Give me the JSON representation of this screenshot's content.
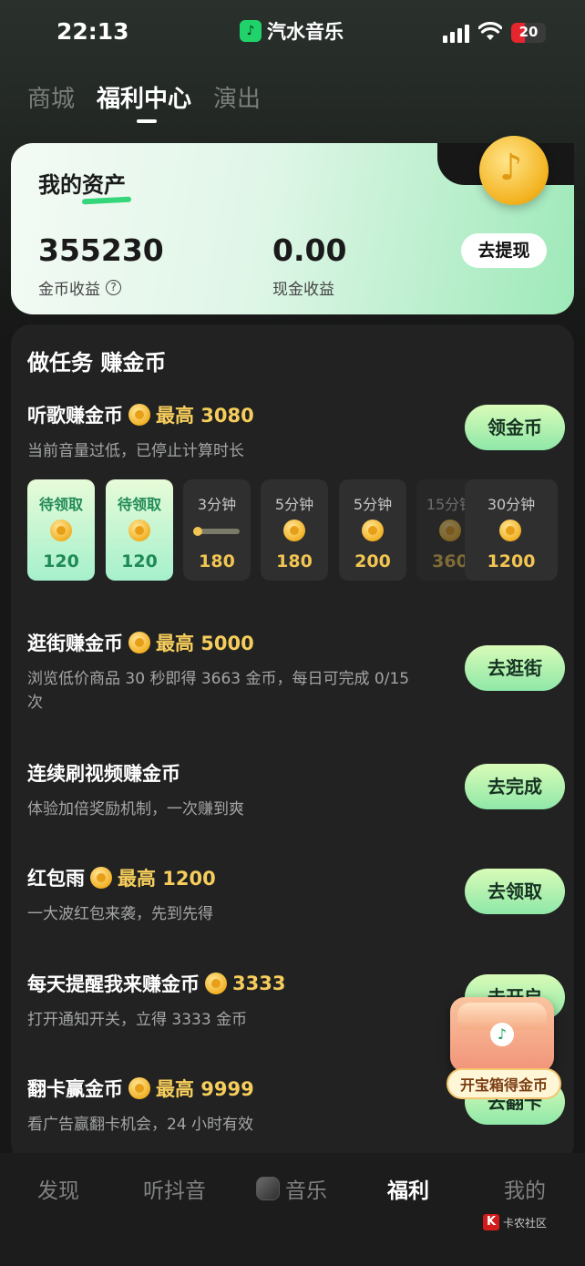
{
  "status": {
    "time": "22:13",
    "app_name": "汽水音乐",
    "battery": "20"
  },
  "top_tabs": [
    "商城",
    "福利中心",
    "演出"
  ],
  "assets": {
    "title_prefix": "我的",
    "title_highlight": "资产",
    "coins_value": "355230",
    "coins_label": "金币收益",
    "cash_value": "0.00",
    "cash_label": "现金收益",
    "withdraw_label": "去提现"
  },
  "tasks": {
    "title": "做任务 赚金币",
    "listen": {
      "title": "听歌赚金币",
      "reward": "最高 3080",
      "subtitle": "当前音量过低，已停止计算时长",
      "button": "领金币",
      "slots": [
        {
          "label": "待领取",
          "amount": "120",
          "state": "claim"
        },
        {
          "label": "待领取",
          "amount": "120",
          "state": "claim"
        },
        {
          "label": "3分钟",
          "amount": "180",
          "state": "progress",
          "progress": 0.05
        },
        {
          "label": "5分钟",
          "amount": "180",
          "state": "locked"
        },
        {
          "label": "5分钟",
          "amount": "200",
          "state": "locked"
        },
        {
          "label": "15分钟",
          "amount": "360",
          "state": "dim"
        },
        {
          "label": "30分钟",
          "amount": "1200",
          "state": "locked"
        }
      ]
    },
    "shop": {
      "title": "逛街赚金币",
      "reward": "最高 5000",
      "subtitle": "浏览低价商品 30 秒即得 3663 金币，每日可完成 0/15 次",
      "button": "去逛街"
    },
    "video": {
      "title": "连续刷视频赚金币",
      "subtitle": "体验加倍奖励机制，一次赚到爽",
      "button": "去完成"
    },
    "redpacket": {
      "title": "红包雨",
      "reward": "最高 1200",
      "subtitle": "一大波红包来袭，先到先得",
      "button": "去领取"
    },
    "remind": {
      "title": "每天提醒我来赚金币",
      "reward": "3333",
      "subtitle": "打开通知开关，立得 3333 金币",
      "button": "去开启"
    },
    "flipcard": {
      "title": "翻卡赢金币",
      "reward": "最高 9999",
      "subtitle": "看广告赢翻卡机会，24 小时有效",
      "button": "去翻卡"
    }
  },
  "chest_label": "开宝箱得金币",
  "bottom_nav": [
    "发现",
    "听抖音",
    "音乐",
    "福利",
    "我的"
  ],
  "watermark": "卡农社区"
}
